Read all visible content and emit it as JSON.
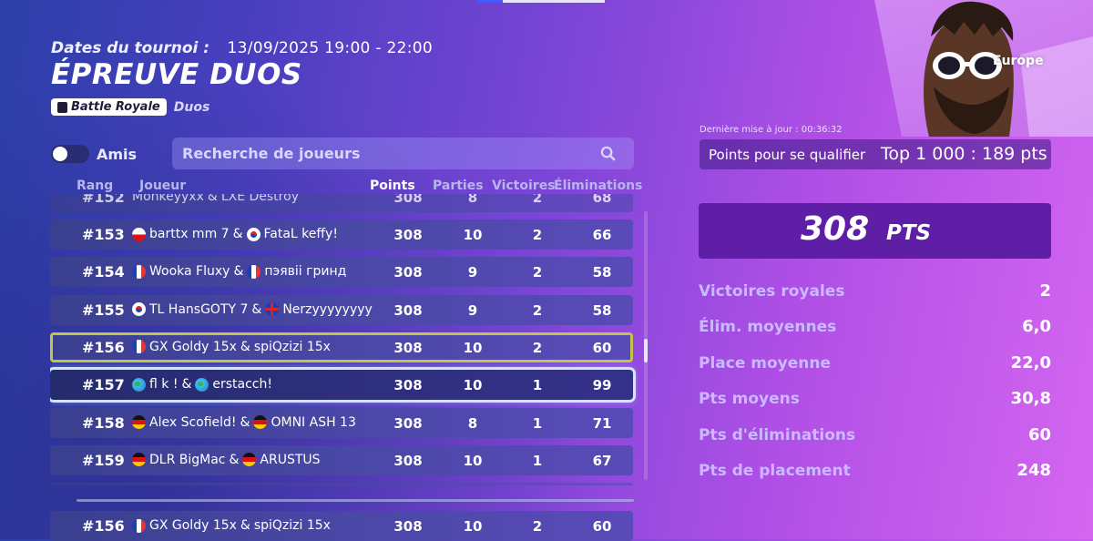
{
  "header": {
    "dates_label": "Dates du tournoi :",
    "dates_value": "13/09/2025 19:00 - 22:00",
    "title": "ÉPREUVE DUOS",
    "mode_badge": "Battle Royale",
    "mode_sub": "Duos"
  },
  "filters": {
    "friends_label": "Amis",
    "friends_toggle_on": false,
    "search_placeholder": "Recherche de joueurs"
  },
  "table": {
    "headers": {
      "rank": "Rang",
      "player": "Joueur",
      "points": "Points",
      "matches": "Parties",
      "wins": "Victoires",
      "elims": "Éliminations"
    },
    "partial_top": {
      "rank": "#152",
      "p1": "Monkeyyxx",
      "p2": "LXE Destroy",
      "points": "308",
      "matches": "8",
      "wins": "2",
      "elims": "68"
    },
    "rows": [
      {
        "rank": "#153",
        "f1": "pl",
        "p1": "barttx mm 7",
        "f2": "kr",
        "p2": "FataL keffy!",
        "points": "308",
        "matches": "10",
        "wins": "2",
        "elims": "66"
      },
      {
        "rank": "#154",
        "f1": "fr",
        "p1": "Wooka Fluxy",
        "f2": "fr",
        "p2": "пэявіі гринд",
        "points": "308",
        "matches": "9",
        "wins": "2",
        "elims": "58"
      },
      {
        "rank": "#155",
        "f1": "kr",
        "p1": "TL HansGOTY 7",
        "f2": "gb",
        "p2": "Nerzyyyyyyyy",
        "points": "308",
        "matches": "9",
        "wins": "2",
        "elims": "58"
      },
      {
        "rank": "#156",
        "f1": "fr",
        "p1": "GX Goldy 15x",
        "f2": "",
        "p2": "spiQzizi 15x",
        "points": "308",
        "matches": "10",
        "wins": "2",
        "elims": "60"
      },
      {
        "rank": "#157",
        "f1": "world",
        "p1": "fl k !",
        "f2": "world",
        "p2": "erstacch!",
        "points": "308",
        "matches": "10",
        "wins": "1",
        "elims": "99"
      },
      {
        "rank": "#158",
        "f1": "de",
        "p1": "Alex Scofield!",
        "f2": "de",
        "p2": "OMNI ASH 13",
        "points": "308",
        "matches": "8",
        "wins": "1",
        "elims": "71"
      },
      {
        "rank": "#159",
        "f1": "de",
        "p1": "DLR BigMac",
        "f2": "de",
        "p2": "ARUSTUS",
        "points": "308",
        "matches": "10",
        "wins": "1",
        "elims": "67"
      }
    ],
    "pinned": {
      "rank": "#156",
      "f1": "fr",
      "p1": "GX Goldy 15x",
      "f2": "",
      "p2": "spiQzizi 15x",
      "points": "308",
      "matches": "10",
      "wins": "2",
      "elims": "60"
    }
  },
  "panel": {
    "region": "Europe",
    "updated": "Dernière mise à jour : 00:36:32",
    "qualify_label": "Points pour se qualifier",
    "qualify_value": "Top 1 000 : 189 pts",
    "points_big": "308",
    "points_unit": "PTS",
    "stats": [
      {
        "label": "Victoires royales",
        "value": "2"
      },
      {
        "label": "Élim. moyennes",
        "value": "6,0"
      },
      {
        "label": "Place moyenne",
        "value": "22,0"
      },
      {
        "label": "Pts moyens",
        "value": "30,8"
      },
      {
        "label": "Pts d'éliminations",
        "value": "60"
      },
      {
        "label": "Pts de placement",
        "value": "248"
      }
    ]
  },
  "colors": {
    "highlight_yellow": "#c5c44a",
    "highlight_white": "#d6e6ff",
    "points_box": "#5e1fa6"
  },
  "icons": [
    "search-icon",
    "battle-royale-icon",
    "flag-icons",
    "character-portrait"
  ]
}
